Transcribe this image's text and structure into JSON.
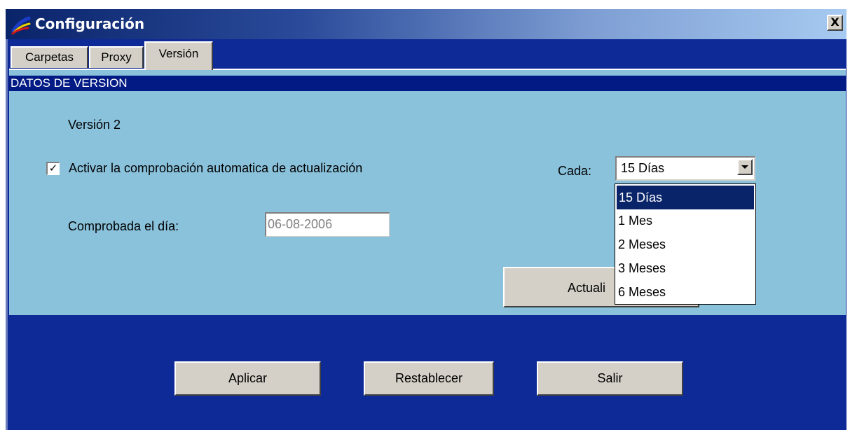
{
  "window": {
    "title": "Configuración",
    "close_label": "X"
  },
  "tabs": [
    {
      "label": "Carpetas",
      "active": false
    },
    {
      "label": "Proxy",
      "active": false
    },
    {
      "label": "Versión",
      "active": true
    }
  ],
  "section": {
    "header": "DATOS DE VERSION",
    "version_label": "Versión  2",
    "auto_update": {
      "checked": true,
      "check_mark": "✓",
      "label": "Activar la comprobación automatica de actualización"
    },
    "frequency": {
      "label": "Cada:",
      "selected": "15 Días",
      "options": [
        "15 Días",
        "1 Mes",
        "2 Meses",
        "3 Meses",
        "6 Meses"
      ]
    },
    "checked_date": {
      "label": "Comprobada el día:",
      "value": "06-08-2006"
    },
    "update_button_label": "Actuali"
  },
  "buttons": {
    "apply": "Aplicar",
    "reset": "Restablecer",
    "exit": "Salir"
  },
  "colors": {
    "title_gradient_start": "#0a246a",
    "title_gradient_end": "#a6caf0",
    "background_blue": "#0d2a96",
    "panel_light_blue": "#8ac2dc",
    "section_header": "#021a84",
    "selection": "#0a246a"
  }
}
